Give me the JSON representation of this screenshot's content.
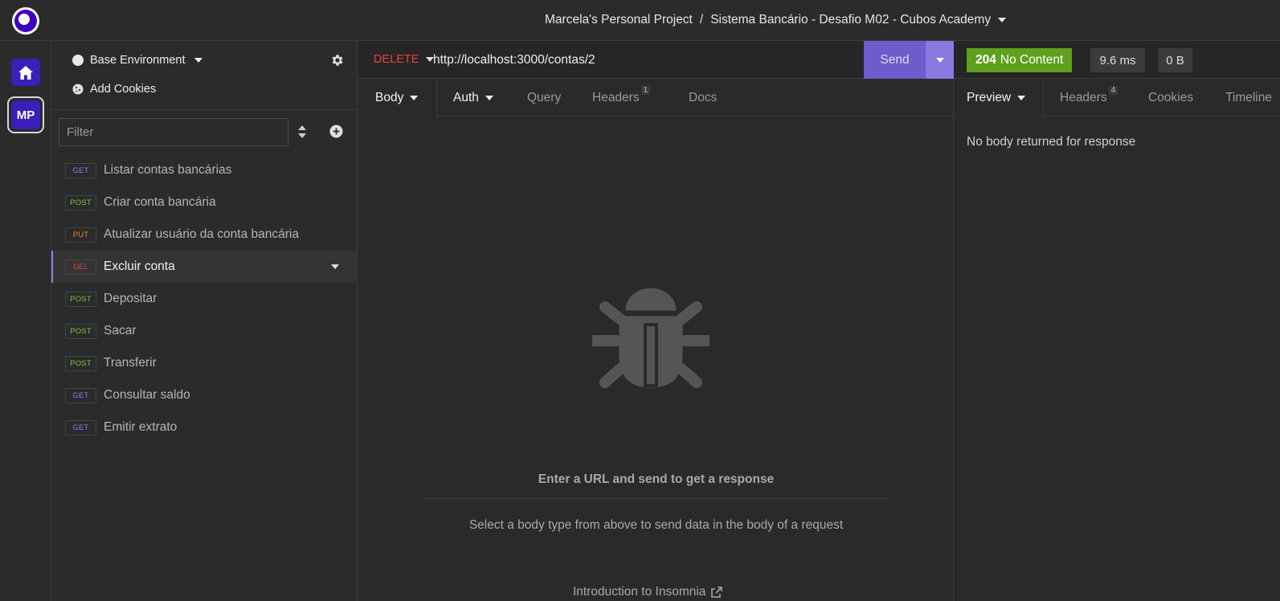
{
  "topbar": {
    "project": "Marcela's Personal Project",
    "separator": "/",
    "collection": "Sistema Bancário - Desafio M02 - Cubos Academy"
  },
  "rail": {
    "workspace_initials": "MP"
  },
  "sidebar": {
    "environment": "Base Environment",
    "add_cookies": "Add Cookies",
    "filter_placeholder": "Filter",
    "requests": [
      {
        "method": "GET",
        "name": "Listar contas bancárias",
        "color": "#8a7ef2"
      },
      {
        "method": "POST",
        "name": "Criar conta bancária",
        "color": "#7cc23a"
      },
      {
        "method": "PUT",
        "name": "Atualizar usuário da conta bancária",
        "color": "#e8862b"
      },
      {
        "method": "DEL",
        "name": "Excluir conta",
        "color": "#e0453c"
      },
      {
        "method": "POST",
        "name": "Depositar",
        "color": "#7cc23a"
      },
      {
        "method": "POST",
        "name": "Sacar",
        "color": "#7cc23a"
      },
      {
        "method": "POST",
        "name": "Transferir",
        "color": "#7cc23a"
      },
      {
        "method": "GET",
        "name": "Consultar saldo",
        "color": "#8a7ef2"
      },
      {
        "method": "GET",
        "name": "Emitir extrato",
        "color": "#8a7ef2"
      }
    ]
  },
  "request": {
    "method": "DELETE",
    "method_color": "#e0453c",
    "url": "http://localhost:3000/contas/2",
    "send_label": "Send",
    "tabs": {
      "body": "Body",
      "auth": "Auth",
      "query": "Query",
      "headers": "Headers",
      "headers_count": "1",
      "docs": "Docs"
    },
    "empty": {
      "title": "Enter a URL and send to get a response",
      "subtitle": "Select a body type from above to send data in the body of a request",
      "intro_link": "Introduction to Insomnia"
    }
  },
  "response": {
    "status_code": "204",
    "status_text": "No Content",
    "time": "9.6 ms",
    "size": "0 B",
    "tabs": {
      "preview": "Preview",
      "headers": "Headers",
      "headers_count": "4",
      "cookies": "Cookies",
      "timeline": "Timeline"
    },
    "body_message": "No body returned for response"
  },
  "icons": {
    "logo": "insomnia-logo-icon",
    "home": "home-icon",
    "gear": "gear-icon",
    "cookie": "cookie-icon",
    "sort": "sort-icon",
    "add": "plus-circle-icon",
    "bug": "bug-icon",
    "external": "external-link-icon"
  }
}
